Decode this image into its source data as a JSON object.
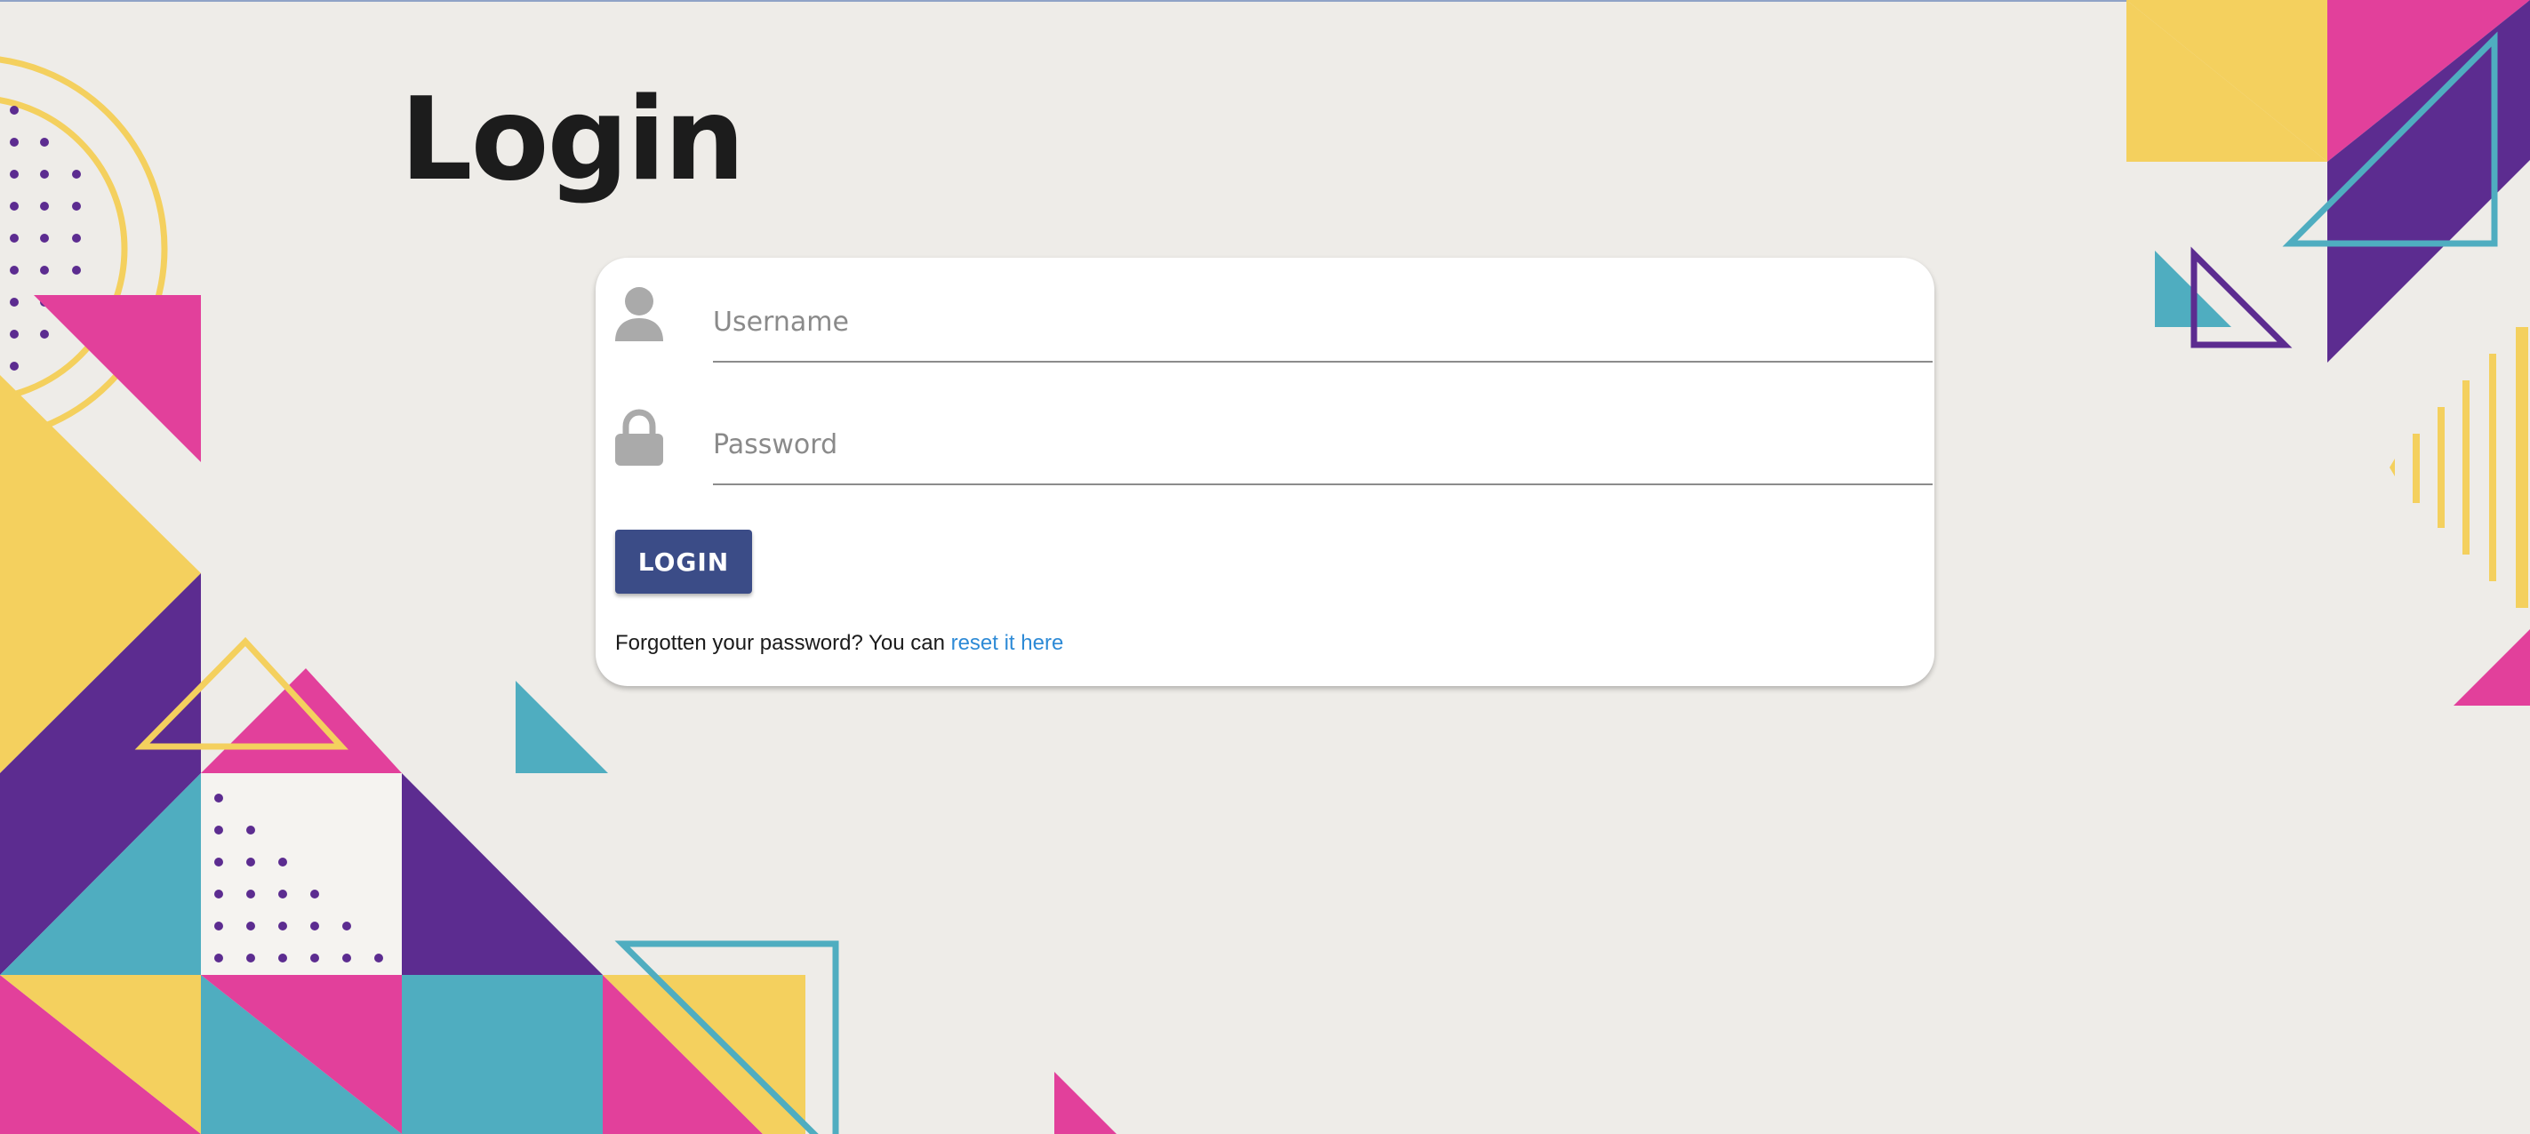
{
  "page": {
    "title": "Login"
  },
  "login_form": {
    "username_placeholder": "Username",
    "password_placeholder": "Password",
    "username_icon": "user-icon",
    "password_icon": "lock-icon",
    "submit_label": "LOGIN",
    "forgot_text": "Forgotten your password? You can ",
    "reset_link_text": "reset it here"
  },
  "colors": {
    "background": "#eeece8",
    "button": "#3b4c87",
    "link": "#2d8ad6",
    "shape_yellow": "#f4d05e",
    "shape_pink": "#e2409b",
    "shape_purple": "#5c2c90",
    "shape_teal": "#4fadc0"
  }
}
